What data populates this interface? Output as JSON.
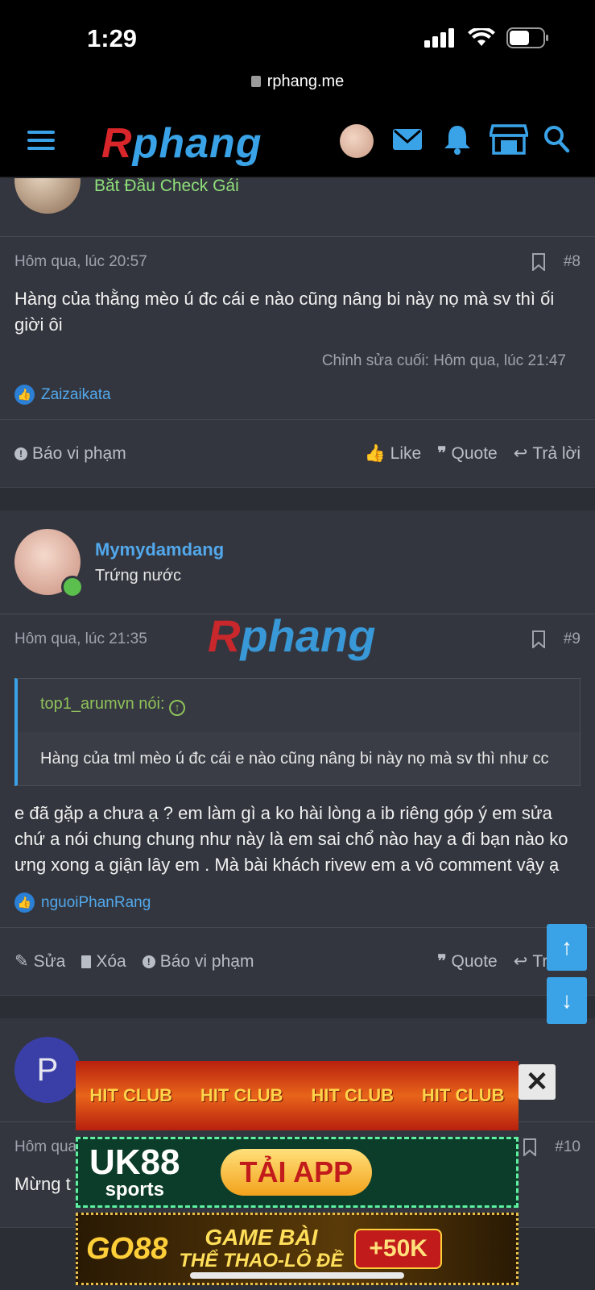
{
  "status_bar": {
    "time": "1:29"
  },
  "browser": {
    "url": "rphang.me"
  },
  "nav": {
    "logo_r": "R",
    "logo_rest": "phang"
  },
  "top_post_author": {
    "title": "Bắt Đầu Check Gái"
  },
  "post8": {
    "timestamp": "Hôm qua, lúc 20:57",
    "number": "#8",
    "body": "Hàng của thằng mèo ú đc cái e nào cũng nâng bi này nọ mà sv thì ối giời ôi",
    "edited": "Chỉnh sửa cuối: Hôm qua, lúc 21:47",
    "liked_by": "Zaizaikata",
    "report": "Báo vi phạm",
    "like": "Like",
    "quote": "Quote",
    "reply": "Trả lời"
  },
  "post9": {
    "author": "Mymydamdang",
    "author_title": "Trứng nước",
    "timestamp": "Hôm qua, lúc 21:35",
    "number": "#9",
    "quote_author": "top1_arumvn nói:",
    "quote_body": "Hàng của tml mèo ú đc cái e nào cũng nâng bi này nọ mà sv thì như cc",
    "body": "e đã gặp a chưa ạ ? em làm gì a ko hài lòng a ib riêng góp ý em sửa chứ a nói chung chung như này là em sai chổ nào hay a đi bạn nào ko ưng xong a giận lây em . Mà bài khách rivew em a vô comment vậy ạ",
    "liked_by": "nguoiPhanRang",
    "edit": "Sửa",
    "delete": "Xóa",
    "report": "Báo vi phạm",
    "quote": "Quote",
    "reply": "Trả lời"
  },
  "post10": {
    "avatar_letter": "P",
    "timestamp": "Hôm qua",
    "number": "#10",
    "body": "Mừng t"
  },
  "watermark": {
    "r": "R",
    "rest": "phang"
  },
  "ads": {
    "ad1_text": "HIT CLUB",
    "ad2_brand": "UK88",
    "ad2_sub": "sports",
    "ad2_cta": "TẢI APP",
    "ad3_brand": "GO88",
    "ad3_line1": "GAME BÀI",
    "ad3_line2": "THỂ THAO-LÔ ĐỀ",
    "ad3_bonus": "+50K"
  },
  "colors": {
    "accent": "#3aa3e8",
    "background": "#2b2e35",
    "post_bg": "#33363e",
    "quote_green": "#8fc15a"
  }
}
